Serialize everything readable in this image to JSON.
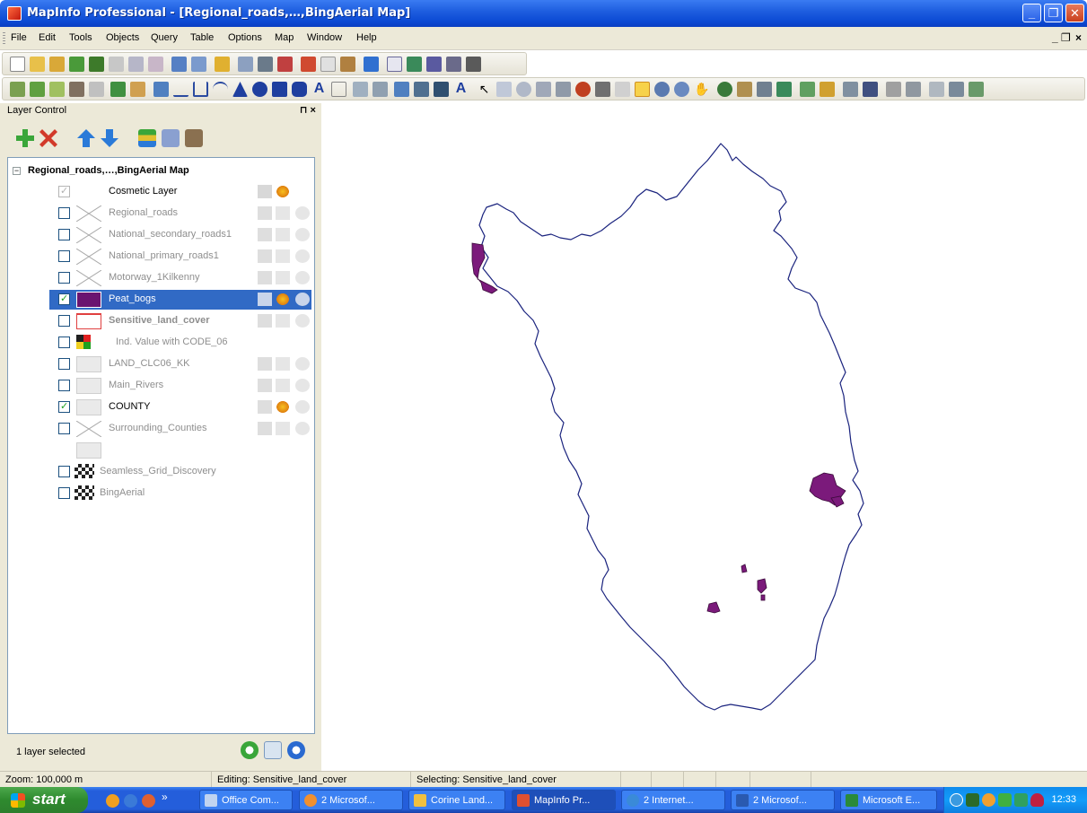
{
  "window": {
    "title": "MapInfo Professional - [Regional_roads,…,BingAerial Map]"
  },
  "menubar": {
    "items": [
      "File",
      "Edit",
      "Tools",
      "Objects",
      "Query",
      "Table",
      "Options",
      "Map",
      "Window",
      "Help"
    ]
  },
  "layer_control": {
    "title": "Layer Control",
    "pin_close": "⊓ ×",
    "root_label": "Regional_roads,…,BingAerial Map",
    "layers": [
      {
        "name": "Cosmetic Layer",
        "checked": true
      },
      {
        "name": "Regional_roads",
        "checked": false
      },
      {
        "name": "National_secondary_roads1",
        "checked": false
      },
      {
        "name": "National_primary_roads1",
        "checked": false
      },
      {
        "name": "Motorway_1Kilkenny",
        "checked": false
      },
      {
        "name": "Peat_bogs",
        "checked": true,
        "selected": true
      },
      {
        "name": "Sensitive_land_cover",
        "checked": false
      },
      {
        "name": "Ind. Value with CODE_06",
        "checked": false
      },
      {
        "name": "LAND_CLC06_KK",
        "checked": false
      },
      {
        "name": "Main_Rivers",
        "checked": false
      },
      {
        "name": "COUNTY",
        "checked": true
      },
      {
        "name": "Surrounding_Counties",
        "checked": false
      },
      {
        "name": "Seamless_Grid_Discovery",
        "checked": false
      },
      {
        "name": "BingAerial",
        "checked": false
      }
    ],
    "footer": "1 layer selected"
  },
  "statusbar": {
    "zoom": "Zoom: 100,000 m",
    "editing": "Editing: Sensitive_land_cover",
    "selecting": "Selecting: Sensitive_land_cover"
  },
  "taskbar": {
    "start": "start",
    "buttons": [
      "Office Com...",
      "2 Microsof...",
      "Corine Land...",
      "MapInfo Pr...",
      "2 Internet...",
      "2 Microsof...",
      "Microsoft E..."
    ],
    "clock": "12:33"
  },
  "colors": {
    "county_outline": "#1a237e",
    "peat_bog_fill": "#7b1a7b",
    "selection": "#316ac5"
  }
}
